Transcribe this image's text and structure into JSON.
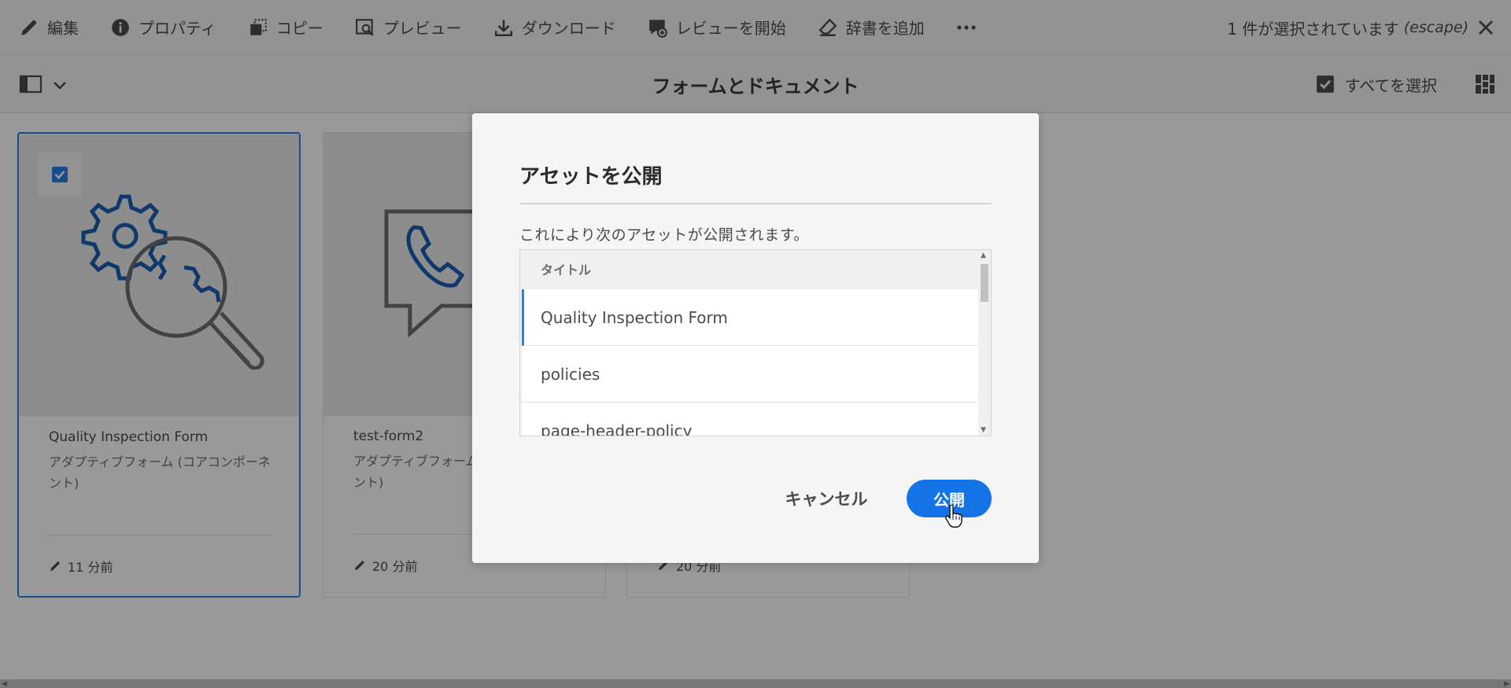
{
  "actionbar": {
    "items": [
      {
        "label": "編集",
        "icon": "pencil-icon"
      },
      {
        "label": "プロパティ",
        "icon": "info-icon"
      },
      {
        "label": "コピー",
        "icon": "copy-icon"
      },
      {
        "label": "プレビュー",
        "icon": "preview-icon"
      },
      {
        "label": "ダウンロード",
        "icon": "download-icon"
      },
      {
        "label": "レビューを開始",
        "icon": "review-icon"
      },
      {
        "label": "辞書を追加",
        "icon": "eraser-icon"
      }
    ],
    "more_icon": "more-icon",
    "selection_status": "1 件が選択されています",
    "selection_escape": "(escape)",
    "close_icon": "close-icon"
  },
  "titlebar": {
    "title": "フォームとドキュメント",
    "select_all": "すべてを選択",
    "rail_icon": "rail-toggle-icon",
    "view_icon": "view-switch-icon"
  },
  "cards": [
    {
      "name": "Quality Inspection Form",
      "type": "アダプティブフォーム (コアコンポーネント)",
      "modified": "11 分前",
      "selected": true,
      "thumb_icon": "gear-magnifier-icon"
    },
    {
      "name": "test-form2",
      "type": "アダプティブフォーム (コアコンポーネント)",
      "modified": "20 分前",
      "selected": false,
      "thumb_icon": "phone-chat-icon"
    },
    {
      "name": "",
      "type": "",
      "modified": "20 分前",
      "selected": false,
      "thumb_icon": ""
    }
  ],
  "dialog": {
    "title": "アセットを公開",
    "description": "これにより次のアセットが公開されます。",
    "table_header": "タイトル",
    "rows": [
      "Quality Inspection Form",
      "policies",
      "page-header-policy"
    ],
    "cancel": "キャンセル",
    "publish": "公開"
  },
  "colors": {
    "accent": "#1473e6",
    "selection": "#2680eb",
    "icon_blue": "#1a5fb4",
    "icon_gray": "#6e6e6e"
  }
}
